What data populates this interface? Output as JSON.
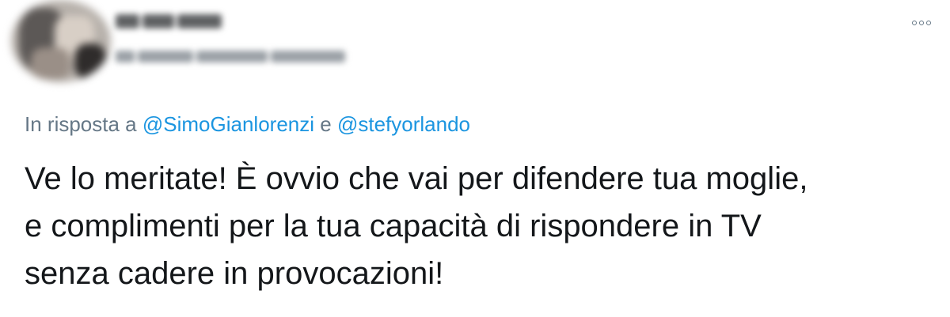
{
  "author": {
    "name_redacted": true,
    "handle_redacted": true
  },
  "menu": {
    "icon": "more-options-icon"
  },
  "reply": {
    "prefix": "In risposta a",
    "mention1": "@SimoGianlorenzi",
    "joiner": "e",
    "mention2": "@stefyorlando"
  },
  "tweet": {
    "lines": [
      "Ve lo meritate! È ovvio che vai per difendere tua moglie,",
      "e complimenti per la tua capacità di rispondere in TV",
      "senza cadere in provocazioni!"
    ]
  },
  "colors": {
    "text": "#14171a",
    "secondary": "#657786",
    "link": "#1b95e0"
  }
}
